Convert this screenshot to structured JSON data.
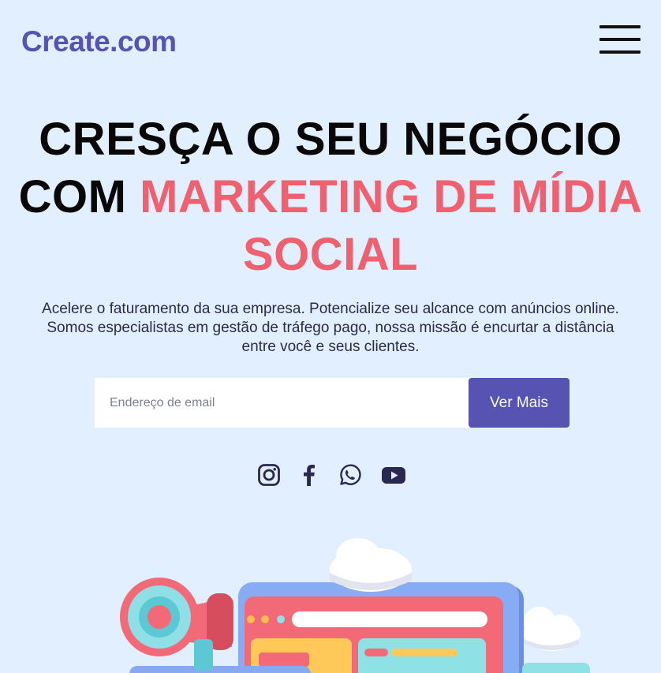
{
  "header": {
    "logo": "Create.com",
    "menu_icon": "hamburger-menu-icon"
  },
  "hero": {
    "title_line1": "CRESÇA O SEU NEGÓCIO",
    "title_line2_plain": "COM",
    "title_line2_accent": "MARKETING DE MÍDIA",
    "title_line3_accent": "SOCIAL",
    "description_line1": "Acelere o faturamento da sua empresa. Potencialize seu alcance com anúncios online.",
    "description_line2": "Somos especialistas em gestão de tráfego pago, nossa missão é encurtar a distância",
    "description_line3": "entre você e seus clientes."
  },
  "signup": {
    "email_placeholder": "Endereço de email",
    "email_value": "",
    "button_label": "Ver Mais"
  },
  "social": {
    "icons": [
      "instagram-icon",
      "facebook-icon",
      "whatsapp-icon",
      "youtube-icon"
    ]
  },
  "colors": {
    "background": "#e2efff",
    "brand": "#5653b2",
    "accent": "#f0606f",
    "title": "#080808",
    "icon": "#2a2850"
  },
  "illustration": {
    "icon": "social-media-marketing-illustration"
  }
}
